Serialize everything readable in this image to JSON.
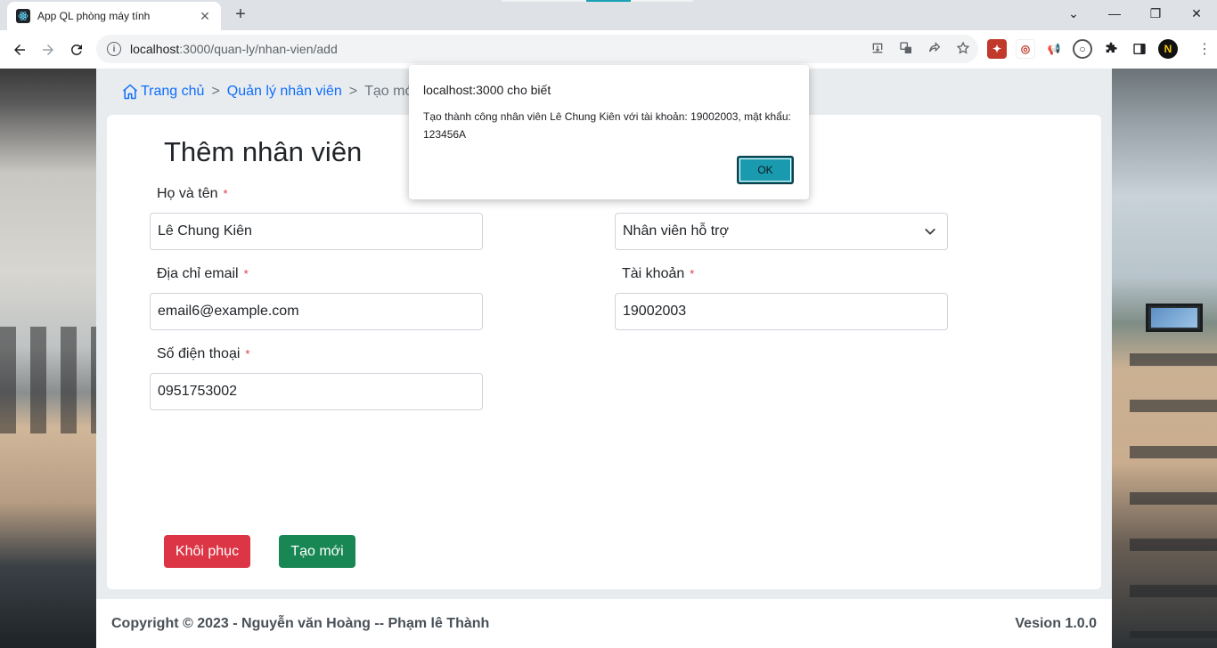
{
  "browser": {
    "tab_title": "App QL phòng máy tính",
    "tab_close": "✕",
    "new_tab": "+",
    "url_host": "localhost",
    "url_path": ":3000/quan-ly/nhan-vien/add",
    "window_controls": {
      "minimize": "—",
      "restore": "❐",
      "close": "✕",
      "tab_search": "⌄"
    }
  },
  "breadcrumb": {
    "home": "Trang chủ",
    "manage": "Quản lý nhân viên",
    "current": "Tạo mới",
    "separator": ">"
  },
  "form": {
    "title": "Thêm nhân viên",
    "required_mark": "*",
    "fields": {
      "name": {
        "label": "Họ và tên",
        "value": "Lê Chung Kiên"
      },
      "email": {
        "label": "Địa chỉ email",
        "value": "email6@example.com"
      },
      "phone": {
        "label": "Số điện thoại",
        "value": "0951753002"
      },
      "role": {
        "value": "Nhân viên hỗ trợ"
      },
      "account": {
        "label": "Tài khoản",
        "value": "19002003"
      }
    },
    "buttons": {
      "reset": "Khôi phục",
      "create": "Tạo mới"
    }
  },
  "footer": {
    "copyright": "Copyright © 2023 - Nguyễn văn Hoàng -- Phạm lê Thành",
    "version": "Vesion 1.0.0"
  },
  "dialog": {
    "title": "localhost:3000 cho biết",
    "message": "Tạo thành công nhân viên Lê Chung Kiên với tài khoản: 19002003, mật khẩu: 123456A",
    "ok": "OK"
  },
  "colors": {
    "danger": "#dc3545",
    "success": "#198754",
    "link": "#0d6efd",
    "dialog_ok": "#1a9aae"
  }
}
